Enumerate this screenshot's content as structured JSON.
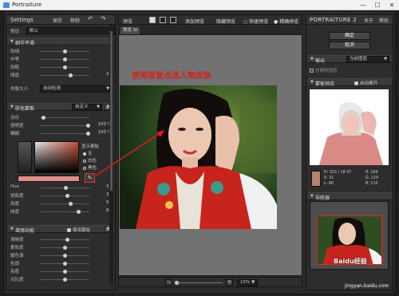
{
  "window": {
    "title": "Portraiture",
    "minimize": "—",
    "maximize": "☐",
    "close": "✕"
  },
  "left_panel": {
    "title": "Settings",
    "save": "保存",
    "delete": "移除",
    "undo": "↶",
    "redo": "↷",
    "preset_label": "预设",
    "preset_value": "默认",
    "detail_section": "细节平滑",
    "detail_sliders": [
      {
        "label": "较细",
        "value": "0",
        "pos": 0.5
      },
      {
        "label": "中等",
        "value": "0",
        "pos": 0.5
      },
      {
        "label": "较粗",
        "value": "0",
        "pos": 0.5
      },
      {
        "label": "阈值",
        "value": "20",
        "pos": 0.62
      }
    ],
    "size_label": "肖像大小",
    "size_value": "自动检测",
    "skin_section": "肤色蒙板",
    "skin_mode": "自定义",
    "skin_badge": "更",
    "skin_sliders": [
      {
        "label": "羽化",
        "value": "0",
        "pos": 0.08
      },
      {
        "label": "透明度",
        "value": "100 %",
        "pos": 0.98
      },
      {
        "label": "模糊",
        "value": "100 %",
        "pos": 0.98
      }
    ],
    "show_mask_label": "显示蒙板",
    "radio_options": [
      {
        "label": "无",
        "on": true
      },
      {
        "label": "白色",
        "on": false
      },
      {
        "label": "黑色",
        "on": false
      }
    ],
    "color_sliders": [
      {
        "label": "Hue",
        "value": "32",
        "pos": 0.52
      },
      {
        "label": "饱和度",
        "value": "32",
        "pos": 0.55
      },
      {
        "label": "亮度",
        "value": "58",
        "pos": 0.62
      },
      {
        "label": "纬度",
        "value": "63",
        "pos": 0.78
      }
    ],
    "enhance_section": "增强功能",
    "enhance_checkbox": "使用蒙板",
    "enhance_badge": "更",
    "enhance_sliders": [
      {
        "label": "清晰度",
        "value": "8",
        "pos": 0.55
      },
      {
        "label": "柔和度",
        "value": "0",
        "pos": 0.5
      },
      {
        "label": "暖色调",
        "value": "0",
        "pos": 0.5
      },
      {
        "label": "色调",
        "value": "0",
        "pos": 0.5
      },
      {
        "label": "亮度",
        "value": "0",
        "pos": 0.5
      },
      {
        "label": "对比度",
        "value": "0",
        "pos": 0.5
      }
    ]
  },
  "toolbar": {
    "preview": "预览",
    "add_preview": "添加预览",
    "hide_preview": "隐藏预览",
    "fast_preview": "快速预览",
    "accurate_preview": "精确预览"
  },
  "tab": {
    "label": "预览 1",
    "close": "×"
  },
  "annotation": "使用吸管点选人物皮肤",
  "zoom_value": "10%",
  "right_panel": {
    "brand": "PORTRAITURE 2",
    "about": "关于",
    "help": "帮助",
    "ok": "确定",
    "cancel": "取消",
    "output_section": "输出",
    "output_value": "当前图层",
    "new_layer": "创建新图层",
    "mask_preview_section": "蒙板预览",
    "auto_expand": "自动展开",
    "color_info": {
      "h": "H: 103 / 18.47",
      "s": "S: 31",
      "l": "L: 80",
      "r": "R: 169",
      "g": "G: 124",
      "b": "B: 110"
    },
    "navigator_section": "导航器"
  },
  "watermark": "Baidu经验",
  "watermark_url": "jingyan.baidu.com"
}
